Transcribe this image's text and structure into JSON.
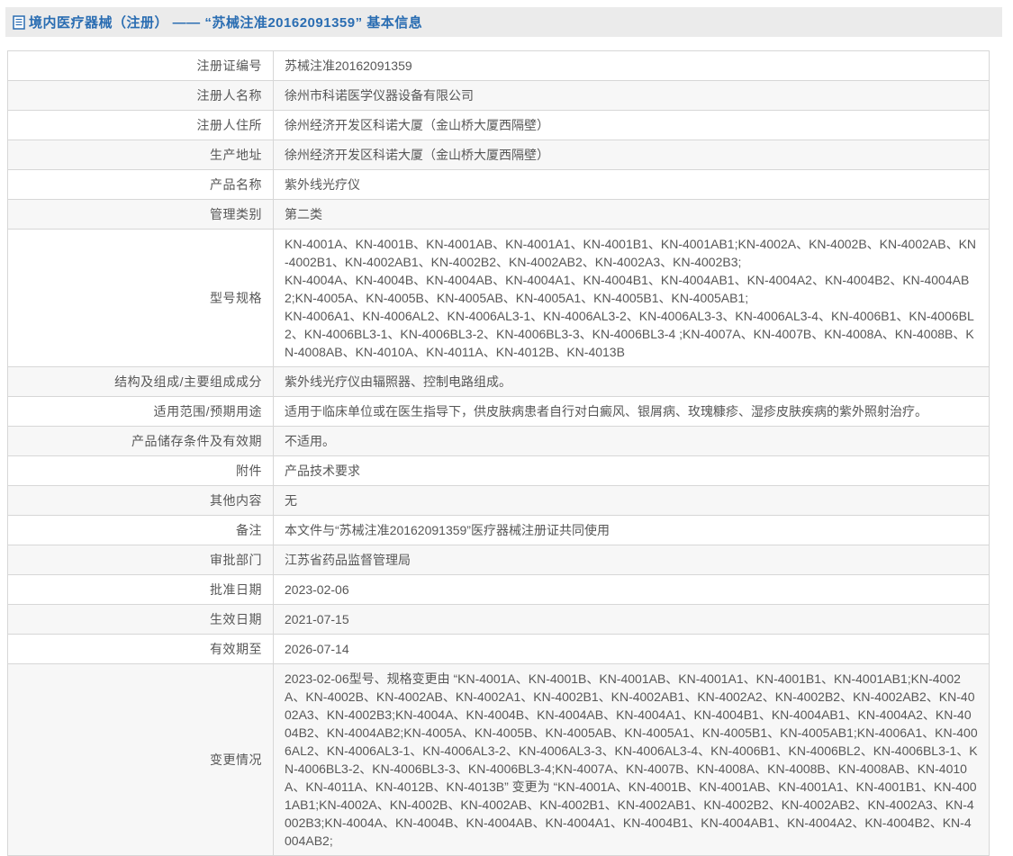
{
  "header": {
    "icon": "document-icon",
    "title": "境内医疗器械（注册） —— “苏械注准20162091359” 基本信息"
  },
  "colors": {
    "accent_blue": "#2a6db2",
    "header_bg": "#ebebeb",
    "row_alt_bg": "#f7f7f7",
    "border": "#d7d7d7",
    "text": "#575757"
  },
  "table": {
    "rows": [
      {
        "label": "注册证编号",
        "value": "苏械注准20162091359"
      },
      {
        "label": "注册人名称",
        "value": "徐州市科诺医学仪器设备有限公司"
      },
      {
        "label": "注册人住所",
        "value": "徐州经济开发区科诺大厦（金山桥大厦西隔壁）"
      },
      {
        "label": "生产地址",
        "value": "徐州经济开发区科诺大厦（金山桥大厦西隔壁）"
      },
      {
        "label": "产品名称",
        "value": "紫外线光疗仪"
      },
      {
        "label": "管理类别",
        "value": "第二类"
      },
      {
        "label": "型号规格",
        "value": "KN-4001A、KN-4001B、KN-4001AB、KN-4001A1、KN-4001B1、KN-4001AB1;KN-4002A、KN-4002B、KN-4002AB、KN-4002B1、KN-4002AB1、KN-4002B2、KN-4002AB2、KN-4002A3、KN-4002B3;\nKN-4004A、KN-4004B、KN-4004AB、KN-4004A1、KN-4004B1、KN-4004AB1、KN-4004A2、KN-4004B2、KN-4004AB2;KN-4005A、KN-4005B、KN-4005AB、KN-4005A1、KN-4005B1、KN-4005AB1;\nKN-4006A1、KN-4006AL2、KN-4006AL3-1、KN-4006AL3-2、KN-4006AL3-3、KN-4006AL3-4、KN-4006B1、KN-4006BL2、KN-4006BL3-1、KN-4006BL3-2、KN-4006BL3-3、KN-4006BL3-4 ;KN-4007A、KN-4007B、KN-4008A、KN-4008B、KN-4008AB、KN-4010A、KN-4011A、KN-4012B、KN-4013B"
      },
      {
        "label": "结构及组成/主要组成成分",
        "value": "紫外线光疗仪由辐照器、控制电路组成。"
      },
      {
        "label": "适用范围/预期用途",
        "value": "适用于临床单位或在医生指导下，供皮肤病患者自行对白癜风、银屑病、玫瑰糠疹、湿疹皮肤疾病的紫外照射治疗。"
      },
      {
        "label": "产品储存条件及有效期",
        "value": "不适用。"
      },
      {
        "label": "附件",
        "value": "产品技术要求"
      },
      {
        "label": "其他内容",
        "value": "无"
      },
      {
        "label": "备注",
        "value": "本文件与“苏械注准20162091359”医疗器械注册证共同使用"
      },
      {
        "label": "审批部门",
        "value": "江苏省药品监督管理局"
      },
      {
        "label": "批准日期",
        "value": "2023-02-06"
      },
      {
        "label": "生效日期",
        "value": "2021-07-15"
      },
      {
        "label": "有效期至",
        "value": "2026-07-14"
      },
      {
        "label": "变更情况",
        "value": "2023-02-06型号、规格变更由 “KN-4001A、KN-4001B、KN-4001AB、KN-4001A1、KN-4001B1、KN-4001AB1;KN-4002A、KN-4002B、KN-4002AB、KN-4002A1、KN-4002B1、KN-4002AB1、KN-4002A2、KN-4002B2、KN-4002AB2、KN-4002A3、KN-4002B3;KN-4004A、KN-4004B、KN-4004AB、KN-4004A1、KN-4004B1、KN-4004AB1、KN-4004A2、KN-4004B2、KN-4004AB2;KN-4005A、KN-4005B、KN-4005AB、KN-4005A1、KN-4005B1、KN-4005AB1;KN-4006A1、KN-4006AL2、KN-4006AL3-1、KN-4006AL3-2、KN-4006AL3-3、KN-4006AL3-4、KN-4006B1、KN-4006BL2、KN-4006BL3-1、KN-4006BL3-2、KN-4006BL3-3、KN-4006BL3-4;KN-4007A、KN-4007B、KN-4008A、KN-4008B、KN-4008AB、KN-4010A、KN-4011A、KN-4012B、KN-4013B” 变更为 “KN-4001A、KN-4001B、KN-4001AB、KN-4001A1、KN-4001B1、KN-4001AB1;KN-4002A、KN-4002B、KN-4002AB、KN-4002B1、KN-4002AB1、KN-4002B2、KN-4002AB2、KN-4002A3、KN-4002B3;KN-4004A、KN-4004B、KN-4004AB、KN-4004A1、KN-4004B1、KN-4004AB1、KN-4004A2、KN-4004B2、KN-4004AB2;"
      }
    ]
  }
}
